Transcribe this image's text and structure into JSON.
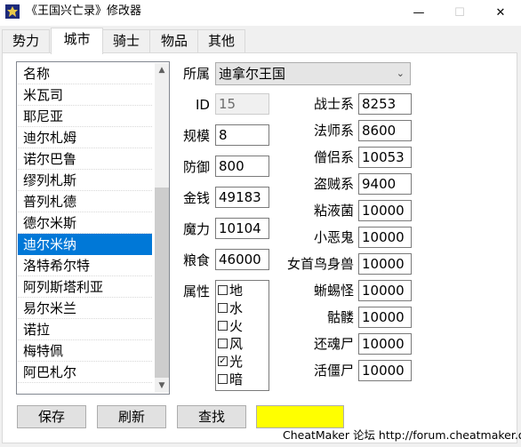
{
  "window": {
    "title": "《王国兴亡录》修改器",
    "minimize_glyph": "—",
    "maximize_glyph": "☐",
    "close_glyph": "✕"
  },
  "tabs": [
    {
      "label": "势力"
    },
    {
      "label": "城市"
    },
    {
      "label": "骑士"
    },
    {
      "label": "物品"
    },
    {
      "label": "其他"
    }
  ],
  "active_tab": "城市",
  "city_list": {
    "items": [
      "名称",
      "米瓦司",
      "耶尼亚",
      "迪尔札姆",
      "诺尔巴鲁",
      "缪列札斯",
      "普列札德",
      "德尔米斯",
      "迪尔米纳",
      "洛特希尔特",
      "阿列斯塔利亚",
      "易尔米兰",
      "诺拉",
      "梅特佩",
      "阿巴札尔"
    ],
    "selected": "迪尔米纳"
  },
  "form": {
    "belongs_label": "所属",
    "belongs_value": "迪拿尔王国",
    "id_label": "ID",
    "id_value": "15",
    "scale_label": "规模",
    "scale_value": "8",
    "defense_label": "防御",
    "defense_value": "800",
    "gold_label": "金钱",
    "gold_value": "49183",
    "magic_label": "魔力",
    "magic_value": "10104",
    "food_label": "粮食",
    "food_value": "46000",
    "attr_label": "属性",
    "attributes": [
      {
        "name": "地",
        "checked": false
      },
      {
        "name": "水",
        "checked": false
      },
      {
        "name": "火",
        "checked": false
      },
      {
        "name": "风",
        "checked": false
      },
      {
        "name": "光",
        "checked": true
      },
      {
        "name": "暗",
        "checked": false
      }
    ]
  },
  "units": [
    {
      "label": "战士系",
      "value": "8253"
    },
    {
      "label": "法师系",
      "value": "8600"
    },
    {
      "label": "僧侣系",
      "value": "10053"
    },
    {
      "label": "盗贼系",
      "value": "9400"
    },
    {
      "label": "粘液菌",
      "value": "10000"
    },
    {
      "label": "小恶鬼",
      "value": "10000"
    },
    {
      "label": "女首鸟身兽",
      "value": "10000"
    },
    {
      "label": "蜥蜴怪",
      "value": "10000"
    },
    {
      "label": "骷髅",
      "value": "10000"
    },
    {
      "label": "还魂尸",
      "value": "10000"
    },
    {
      "label": "活僵尸",
      "value": "10000"
    }
  ],
  "buttons": {
    "save": "保存",
    "refresh": "刷新",
    "search": "查找"
  },
  "status_color": "#ffff00",
  "footer": "CheatMaker 论坛 http://forum.cheatmaker.org/"
}
